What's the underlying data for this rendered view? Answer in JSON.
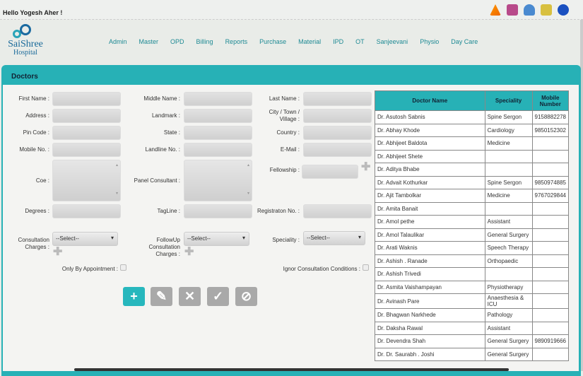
{
  "header": {
    "greeting": "Hello Yogesh Aher !",
    "logo_line1": "SaiShree",
    "logo_line2": "Hospital",
    "nav": [
      "Admin",
      "Master",
      "OPD",
      "Billing",
      "Reports",
      "Purchase",
      "Material",
      "IPD",
      "OT",
      "Sanjeevani",
      "Physio",
      "Day Care"
    ],
    "icons": [
      "warning-icon",
      "notes-icon",
      "user-icon",
      "settings-icon",
      "power-icon"
    ]
  },
  "page": {
    "title": "Doctors"
  },
  "form": {
    "first_name": "First Name :",
    "middle_name": "Middle Name :",
    "last_name": "Last Name :",
    "address": "Address :",
    "landmark": "Landmark :",
    "city": "City / Town / Village :",
    "pin": "Pin Code :",
    "state": "State :",
    "country": "Country :",
    "mobile": "Mobile No. :",
    "landline": "Landline No. :",
    "email": "E-Mail :",
    "coe": "Coe :",
    "panel": "Panel Consultant :",
    "fellowship": "Fellowship :",
    "degrees": "Degrees :",
    "tagline": "TagLine :",
    "registration": "Registraton No. :",
    "consultation": "Consultation Charges :",
    "followup": "FollowUp Consultation Charges :",
    "speciality": "Speciality :",
    "select_placeholder": "--Select--",
    "only_appointment": "Only By Appointment :",
    "ignor": "Ignor Consultation Conditions :"
  },
  "table": {
    "headers": [
      "Doctor Name",
      "Speciality",
      "Mobile Number"
    ],
    "rows": [
      [
        "Dr. Asutosh Sabnis",
        "Spine Sergon",
        "9158882278"
      ],
      [
        "Dr. Abhay Khode",
        "Cardiology",
        "9850152302"
      ],
      [
        "Dr. Abhijeet Baldota",
        "Medicine",
        ""
      ],
      [
        "Dr. Abhijeet Shete",
        "",
        ""
      ],
      [
        "Dr. Aditya Bhabe",
        "",
        ""
      ],
      [
        "Dr. Advait Kothurkar",
        "Spine Sergon",
        "9850974885"
      ],
      [
        "Dr. Ajit Tambolkar",
        "Medicine",
        "9767029844"
      ],
      [
        "Dr. Amita Banait",
        "",
        ""
      ],
      [
        "Dr. Amol pethe",
        "Assistant",
        ""
      ],
      [
        "Dr. Amol Talaulikar",
        "General Surgery",
        ""
      ],
      [
        "Dr. Arati Waknis",
        "Speech Therapy",
        ""
      ],
      [
        "Dr. Ashish . Ranade",
        "Orthopaedic",
        ""
      ],
      [
        "Dr. Ashish Trivedi",
        "",
        ""
      ],
      [
        "Dr. Asmita Vaishampayan",
        "Physiotherapy",
        ""
      ],
      [
        "Dr. Avinash Pare",
        "Anaesthesia & ICU",
        ""
      ],
      [
        "Dr. Bhagwan Narkhede",
        "Pathology",
        ""
      ],
      [
        "Dr. Daksha Rawal",
        "Assistant",
        ""
      ],
      [
        "Dr. Devendra Shah",
        "General Surgery",
        "9890919666"
      ],
      [
        "Dr. Dr. Saurabh . Joshi",
        "General Surgery",
        ""
      ]
    ]
  }
}
